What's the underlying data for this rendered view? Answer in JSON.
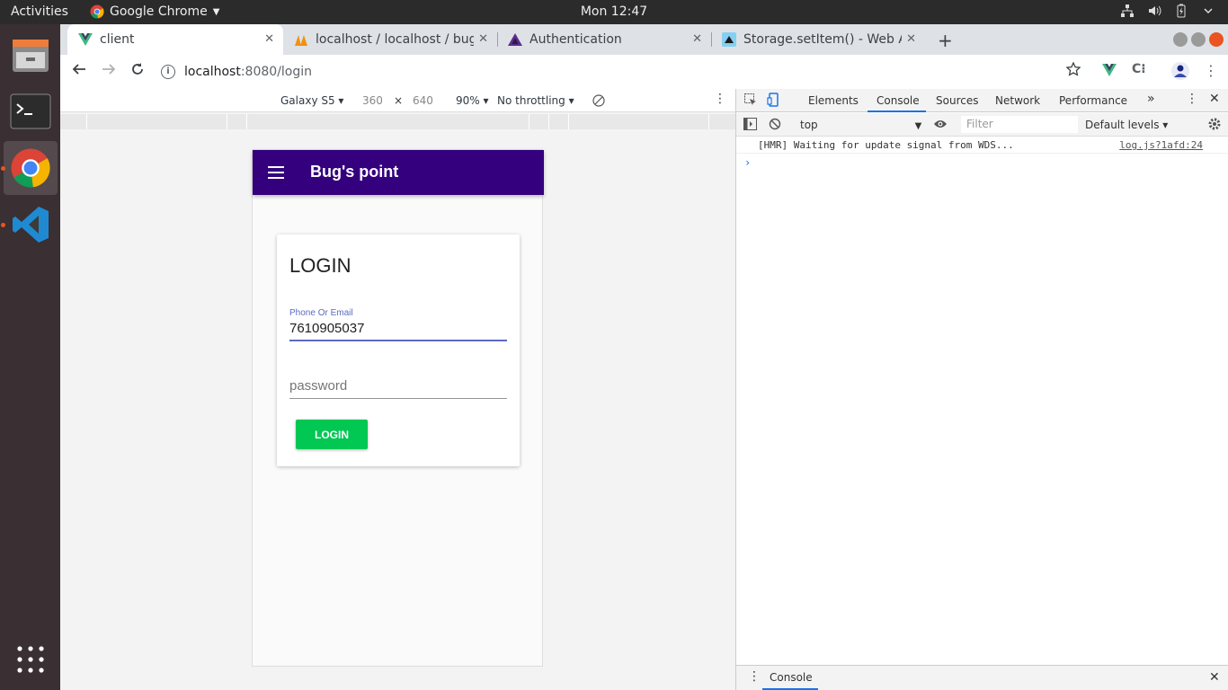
{
  "topbar": {
    "activities": "Activities",
    "app_name": "Google Chrome",
    "clock": "Mon 12:47"
  },
  "tabs": [
    {
      "title": "client"
    },
    {
      "title": "localhost / localhost / bug"
    },
    {
      "title": "Authentication"
    },
    {
      "title": "Storage.setItem() - Web A"
    }
  ],
  "address": {
    "host": "localhost",
    "path": ":8080/login"
  },
  "device_bar": {
    "device": "Galaxy S5",
    "width": "360",
    "times": "×",
    "height": "640",
    "zoom": "90%",
    "throttle": "No throttling"
  },
  "app": {
    "title": "Bug's point",
    "login_heading": "LOGIN",
    "phone_label": "Phone Or Email",
    "phone_value": "7610905037",
    "password_placeholder": "password",
    "login_button": "LOGIN"
  },
  "devtools": {
    "tabs": [
      "Elements",
      "Console",
      "Sources",
      "Network",
      "Performance"
    ],
    "context": "top",
    "filter_placeholder": "Filter",
    "levels": "Default levels",
    "log_message": "[HMR] Waiting for update signal from WDS...",
    "log_source": "log.js?1afd:24",
    "drawer_tab": "Console"
  },
  "colors": {
    "appbar": "#34007e",
    "login_button": "#00c853",
    "field_accent": "#5c6bc0"
  }
}
